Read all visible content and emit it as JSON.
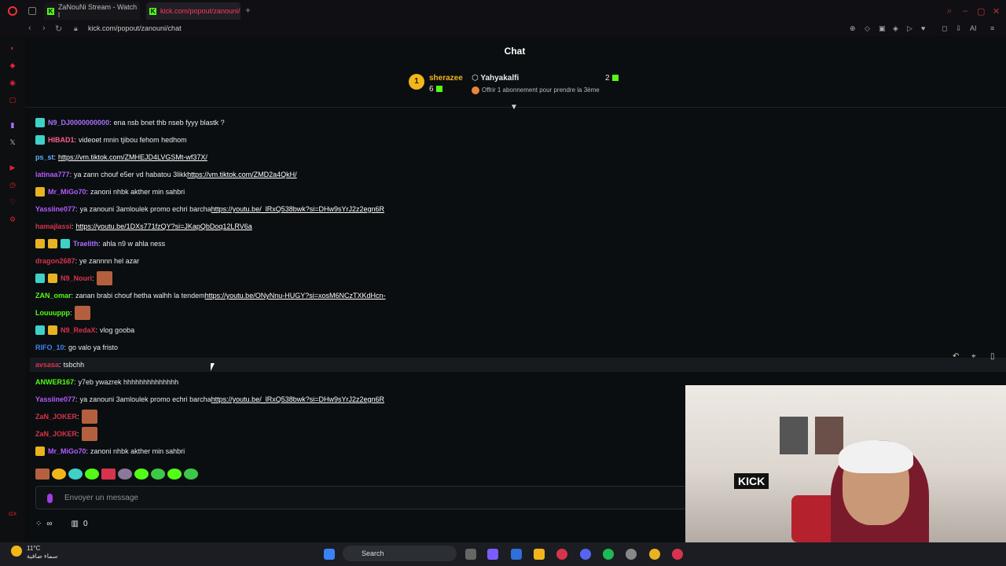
{
  "browser": {
    "tabs": [
      {
        "label": "ZaNouNi Stream - Watch l"
      },
      {
        "label": "kick.com/popout/zanouni/"
      }
    ],
    "url": "kick.com/popout/zanouni/chat",
    "toolbar_right_label": "AI"
  },
  "chat": {
    "title": "Chat",
    "leaderboard": {
      "first": {
        "rank": "1",
        "name": "sherazee",
        "count": "6"
      },
      "second": {
        "name": "Yahyakalfi",
        "count": "2"
      },
      "sub_prompt": "Offrir 1 abonnement pour prendre la 3ème"
    },
    "messages": [
      {
        "user": "N9_DJ0000000000",
        "color": "#a970ff",
        "text": "ena nsb bnet thb nseb fyyy blastk ?",
        "link": ""
      },
      {
        "user": "HIBAD1",
        "color": "#ff5b8b",
        "text": "videoet mnin tjibou fehom hedhom",
        "link": ""
      },
      {
        "user": "ps_st",
        "color": "#5fb2ff",
        "text": "",
        "link": "https://vm.tiktok.com/ZMHEJD4LVGSMt-wf37X/"
      },
      {
        "user": "latinaa777",
        "color": "#b15cff",
        "text": "ya zann chouf e5er vd habatou 3likk",
        "link": "https://vm.tiktok.com/ZMD2a4QkH/"
      },
      {
        "user": "Mr_MiGo70",
        "color": "#b15cff",
        "text": "zanoni nhbk akther min sahbri",
        "link": ""
      },
      {
        "user": "Yassiine077",
        "color": "#b15cff",
        "text": "ya zanouni 3amloulek promo echri barcha",
        "link": "https://youtu.be/_lRxQ538bwk?si=DHw9sYrJ2z2egn6R"
      },
      {
        "user": "hamajlassi",
        "color": "#d8334d",
        "text": "",
        "link": "https://youtu.be/1DXs771fzQY?si=JKapQbDoq12LRV6a"
      },
      {
        "user": "Traelith",
        "color": "#a970ff",
        "text": "ahla n9 w ahla ness",
        "link": ""
      },
      {
        "user": "dragon2687",
        "color": "#d8334d",
        "text": "ye zannnn hel azar",
        "link": ""
      },
      {
        "user": "N9_Nouri",
        "color": "#d8334d",
        "text": "",
        "link": ""
      },
      {
        "user": "ZAN_omar",
        "color": "#53fc18",
        "text": "zanan brabi chouf hetha walhh la tendem",
        "link": "https://youtu.be/ONyNnu-HUGY?si=xosM6NCzTXKdHcn-"
      },
      {
        "user": "Louuuppp",
        "color": "#53fc18",
        "text": "",
        "link": ""
      },
      {
        "user": "N9_RedaX",
        "color": "#d8334d",
        "text": "vlog gooba",
        "link": ""
      },
      {
        "user": "RIFO_10",
        "color": "#3b82f6",
        "text": "go valo ya fristo",
        "link": ""
      },
      {
        "user": "avsasa",
        "color": "#d8334d",
        "text": "tsbchh",
        "link": ""
      },
      {
        "user": "ANWER167",
        "color": "#53fc18",
        "text": "y7eb ywazrek hhhhhhhhhhhhhh",
        "link": ""
      },
      {
        "user": "Yassiine077",
        "color": "#b15cff",
        "text": "ya zanouni 3amloulek promo echri barcha",
        "link": "https://youtu.be/_lRxQ538bwk?si=DHw9sYrJ2z2egn6R"
      },
      {
        "user": "ZaN_JOKER",
        "color": "#d8334d",
        "text": "",
        "link": ""
      },
      {
        "user": "ZaN_JOKER",
        "color": "#d8334d",
        "text": "",
        "link": ""
      },
      {
        "user": "Mr_MiGo70",
        "color": "#b15cff",
        "text": "zanoni nhbk akther min sahbri",
        "link": ""
      }
    ],
    "input_placeholder": "Envoyer un message",
    "points": "0"
  },
  "webcam": {
    "sign_text": "KICK"
  },
  "taskbar": {
    "weather_temp": "11°C",
    "weather_desc": "سماء صافية",
    "search_label": "Search"
  },
  "colors": {
    "kick_green": "#53fc18",
    "accent_red": "#d8334d",
    "gold": "#f2b61b"
  }
}
